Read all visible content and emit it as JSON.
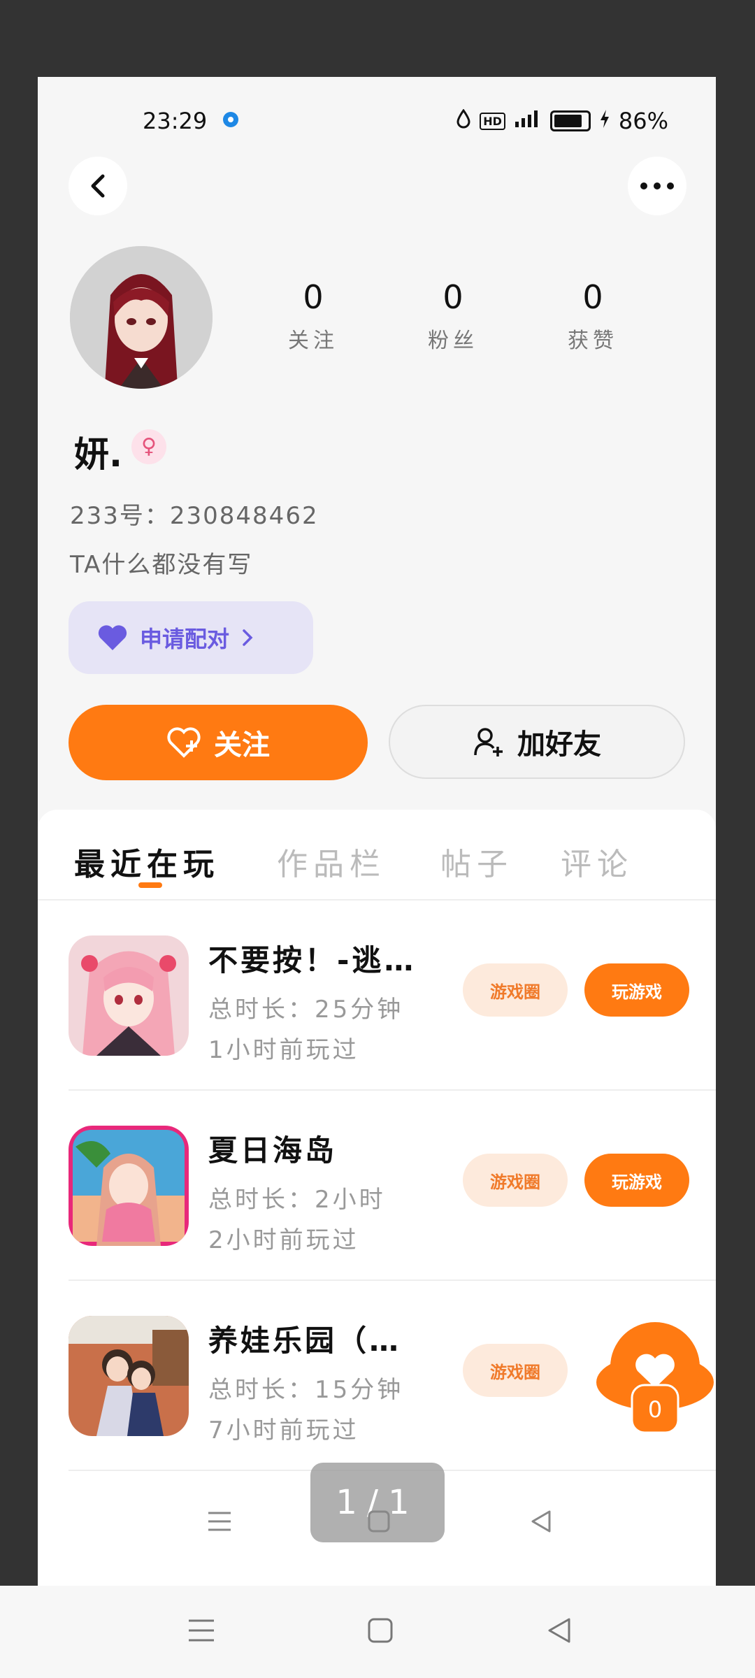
{
  "status_bar": {
    "time": "23:29",
    "hd": "HD",
    "battery_percent": "86%",
    "battery_level": 0.86
  },
  "profile": {
    "stats": [
      {
        "value": "0",
        "label": "关注"
      },
      {
        "value": "0",
        "label": "粉丝"
      },
      {
        "value": "0",
        "label": "获赞"
      }
    ],
    "username": "妍.",
    "gender_symbol": "♀",
    "id_line": "233号：230848462",
    "bio": "TA什么都没有写",
    "pair_button": "申请配对",
    "follow_button": "关注",
    "add_friend_button": "加好友"
  },
  "tabs": [
    {
      "label": "最近在玩",
      "active": true
    },
    {
      "label": "作品栏",
      "active": false
    },
    {
      "label": "帖子",
      "active": false
    },
    {
      "label": "评论",
      "active": false
    }
  ],
  "games": [
    {
      "name": "不要按！-逃…",
      "total_time": "总时长：25分钟",
      "last_played": "1小时前玩过",
      "circle_label": "游戏圈",
      "play_label": "玩游戏"
    },
    {
      "name": "夏日海岛",
      "total_time": "总时长：2小时",
      "last_played": "2小时前玩过",
      "circle_label": "游戏圈",
      "play_label": "玩游戏"
    },
    {
      "name": "养娃乐园（…",
      "total_time": "总时长：15分钟",
      "last_played": "7小时前玩过",
      "circle_label": "游戏圈"
    }
  ],
  "floating_like": {
    "count": "0"
  },
  "pager": "1/1",
  "colors": {
    "accent": "#ff7a12",
    "pair_bg": "#e6e4f6",
    "pair_text": "#6a5be0",
    "light_pill": "#fdeadc"
  },
  "icons": [
    "back-icon",
    "more-icon",
    "heart-icon",
    "follow-heart-icon",
    "add-person-icon",
    "menu-icon",
    "home-icon",
    "back-triangle-icon"
  ]
}
